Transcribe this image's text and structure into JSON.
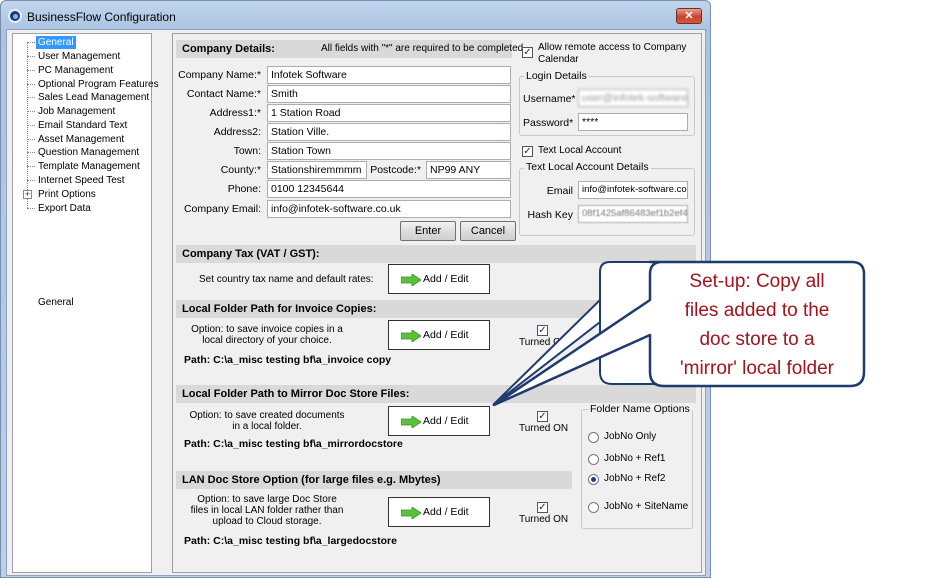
{
  "window": {
    "title": "BusinessFlow Configuration",
    "close_label": "✕"
  },
  "tree": {
    "items": [
      "General",
      "User Management",
      "PC Management",
      "Optional Program Features",
      "Sales Lead Management",
      "Job Management",
      "Email Standard Text",
      "Asset Management",
      "Question Management",
      "Template Management",
      "Internet Speed Test",
      "Print Options",
      "Export Data"
    ],
    "selected": "General",
    "expander": "+",
    "status": "General"
  },
  "company": {
    "header": "Company Details:",
    "required_note": "All fields with \"*\" are required to be completed",
    "labels": {
      "name": "Company  Name:*",
      "contact": "Contact  Name:*",
      "address1": "Address1:*",
      "address2": "Address2:",
      "town": "Town:",
      "county": "County:*",
      "postcode": "Postcode:*",
      "phone": "Phone:",
      "email": "Company Email:"
    },
    "values": {
      "name": "Infotek Software",
      "contact": "Smith",
      "address1": "1 Station Road",
      "address2": "Station Ville.",
      "town": "Station Town",
      "county": "Stationshiremmmm",
      "postcode": "NP99 ANY",
      "phone": "0100 12345644",
      "email": "info@infotek-software.co.uk"
    },
    "enter_label": "Enter",
    "cancel_label": "Cancel"
  },
  "remote": {
    "allow_label": "Allow remote access to Company Calendar",
    "allow_checked": true,
    "login_group": "Login Details",
    "username_label": "Username*",
    "username_value": "user@infotek-software",
    "password_label": "Password*",
    "password_value": "****"
  },
  "textlocal": {
    "account_label": "Text Local Account",
    "account_checked": true,
    "group": "Text Local Account Details",
    "email_label": "Email",
    "email_value": "info@infotek-software.co.uk",
    "hash_label": "Hash Key",
    "hash_value": "08f1425af86483ef1b2ef4"
  },
  "tax": {
    "header": "Company Tax (VAT / GST):",
    "desc": "Set country tax name and default rates:",
    "button": "Add / Edit"
  },
  "invoice": {
    "header": "Local Folder Path for Invoice Copies:",
    "desc": "Option: to save invoice copies in a local directory of your choice.",
    "button": "Add / Edit",
    "turned_on": "Turned ON",
    "checked": true,
    "path": "Path: C:\\a_misc testing bf\\a_invoice copy"
  },
  "mirror": {
    "header": "Local Folder Path to Mirror Doc Store Files:",
    "desc": "Option: to save created documents in a local folder.",
    "button": "Add / Edit",
    "turned_on": "Turned ON",
    "checked": true,
    "path": "Path: C:\\a_misc testing bf\\a_mirrordocstore"
  },
  "folder_options": {
    "title": "Folder Name Options",
    "options": [
      "JobNo Only",
      "JobNo + Ref1",
      "JobNo + Ref2",
      "JobNo + SiteName"
    ],
    "selected": "JobNo + Ref2"
  },
  "lan": {
    "header": "LAN Doc Store Option (for large files e.g. Mbytes)",
    "desc": "Option: to save large Doc Store files in local LAN folder rather than upload to Cloud storage.",
    "button": "Add / Edit",
    "turned_on": "Turned ON",
    "checked": true,
    "path": "Path: C:\\a_misc testing bf\\a_largedocstore"
  },
  "callout": {
    "lines": [
      "Set-up: Copy all",
      "files added to the",
      "doc store to a",
      "'mirror' local folder"
    ],
    "text_color": "#a0141e",
    "border_color": "#1f3a6e"
  }
}
